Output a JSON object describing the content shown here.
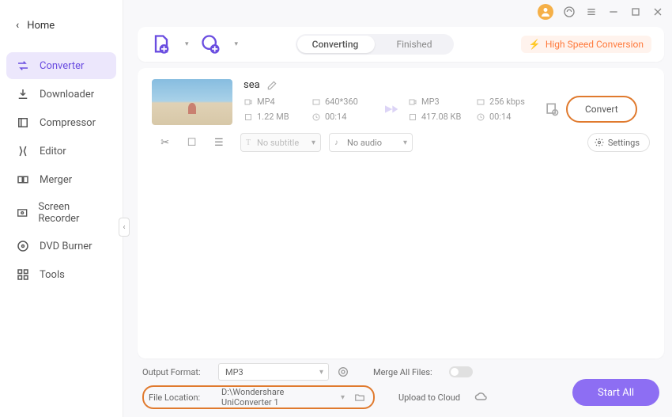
{
  "window": {
    "home_label": "Home"
  },
  "sidebar": {
    "items": [
      {
        "label": "Converter",
        "icon": "converter-icon",
        "active": true
      },
      {
        "label": "Downloader",
        "icon": "downloader-icon"
      },
      {
        "label": "Compressor",
        "icon": "compressor-icon"
      },
      {
        "label": "Editor",
        "icon": "editor-icon"
      },
      {
        "label": "Merger",
        "icon": "merger-icon"
      },
      {
        "label": "Screen Recorder",
        "icon": "screen-recorder-icon"
      },
      {
        "label": "DVD Burner",
        "icon": "dvd-burner-icon"
      },
      {
        "label": "Tools",
        "icon": "tools-icon"
      }
    ]
  },
  "topbar": {
    "tabs": {
      "converting": "Converting",
      "finished": "Finished"
    },
    "hs_label": "High Speed Conversion"
  },
  "file": {
    "name": "sea",
    "src": {
      "format": "MP4",
      "resolution": "640*360",
      "size": "1.22 MB",
      "duration": "00:14"
    },
    "dst": {
      "format": "MP3",
      "bitrate": "256 kbps",
      "size": "417.08 KB",
      "duration": "00:14"
    },
    "convert_label": "Convert",
    "subtitle_placeholder": "No subtitle",
    "audio_placeholder": "No audio",
    "settings_label": "Settings"
  },
  "footer": {
    "output_format_label": "Output Format:",
    "output_format_value": "MP3",
    "merge_label": "Merge All Files:",
    "file_location_label": "File Location:",
    "file_location_value": "D:\\Wondershare UniConverter 1",
    "upload_label": "Upload to Cloud",
    "start_all": "Start All"
  }
}
